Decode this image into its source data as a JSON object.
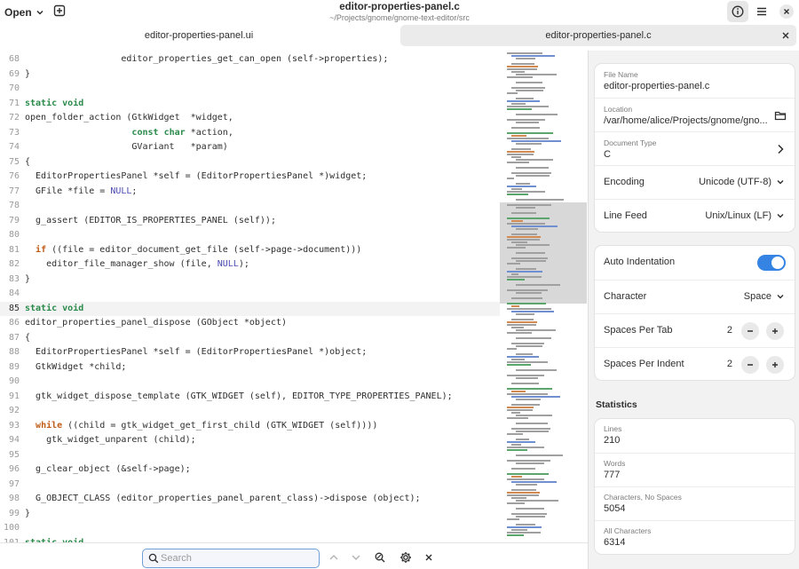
{
  "header": {
    "open_label": "Open",
    "title": "editor-properties-panel.c",
    "subtitle": "~/Projects/gnome/gnome-text-editor/src"
  },
  "tabs": [
    {
      "label": "editor-properties-panel.ui",
      "active": false
    },
    {
      "label": "editor-properties-panel.c",
      "active": true
    }
  ],
  "code_lines": [
    {
      "n": "68",
      "t": "                  editor_properties_get_can_open (self->properties);"
    },
    {
      "n": "69",
      "t": "}"
    },
    {
      "n": "70",
      "t": ""
    },
    {
      "n": "71",
      "t": "static void"
    },
    {
      "n": "72",
      "t": "open_folder_action (GtkWidget  *widget,"
    },
    {
      "n": "73",
      "t": "                    const char *action,"
    },
    {
      "n": "74",
      "t": "                    GVariant   *param)"
    },
    {
      "n": "75",
      "t": "{"
    },
    {
      "n": "76",
      "t": "  EditorPropertiesPanel *self = (EditorPropertiesPanel *)widget;"
    },
    {
      "n": "77",
      "t": "  GFile *file = NULL;"
    },
    {
      "n": "78",
      "t": ""
    },
    {
      "n": "79",
      "t": "  g_assert (EDITOR_IS_PROPERTIES_PANEL (self));"
    },
    {
      "n": "80",
      "t": ""
    },
    {
      "n": "81",
      "t": "  if ((file = editor_document_get_file (self->page->document)))"
    },
    {
      "n": "82",
      "t": "    editor_file_manager_show (file, NULL);"
    },
    {
      "n": "83",
      "t": "}"
    },
    {
      "n": "84",
      "t": ""
    },
    {
      "n": "85",
      "t": "static void"
    },
    {
      "n": "86",
      "t": "editor_properties_panel_dispose (GObject *object)"
    },
    {
      "n": "87",
      "t": "{"
    },
    {
      "n": "88",
      "t": "  EditorPropertiesPanel *self = (EditorPropertiesPanel *)object;"
    },
    {
      "n": "89",
      "t": "  GtkWidget *child;"
    },
    {
      "n": "90",
      "t": ""
    },
    {
      "n": "91",
      "t": "  gtk_widget_dispose_template (GTK_WIDGET (self), EDITOR_TYPE_PROPERTIES_PANEL);"
    },
    {
      "n": "92",
      "t": ""
    },
    {
      "n": "93",
      "t": "  while ((child = gtk_widget_get_first_child (GTK_WIDGET (self))))"
    },
    {
      "n": "94",
      "t": "    gtk_widget_unparent (child);"
    },
    {
      "n": "95",
      "t": ""
    },
    {
      "n": "96",
      "t": "  g_clear_object (&self->page);"
    },
    {
      "n": "97",
      "t": ""
    },
    {
      "n": "98",
      "t": "  G_OBJECT_CLASS (editor_properties_panel_parent_class)->dispose (object);"
    },
    {
      "n": "99",
      "t": "}"
    },
    {
      "n": "100",
      "t": ""
    },
    {
      "n": "101",
      "t": "static void"
    }
  ],
  "current_line": "85",
  "properties": {
    "file_name_label": "File Name",
    "file_name": "editor-properties-panel.c",
    "location_label": "Location",
    "location": "/var/home/alice/Projects/gnome/gno...",
    "doc_type_label": "Document Type",
    "doc_type": "C",
    "encoding_label": "Encoding",
    "encoding": "Unicode (UTF-8)",
    "line_feed_label": "Line Feed",
    "line_feed": "Unix/Linux (LF)"
  },
  "indentation": {
    "auto_label": "Auto Indentation",
    "auto_enabled": true,
    "character_label": "Character",
    "character": "Space",
    "spaces_per_tab_label": "Spaces Per Tab",
    "spaces_per_tab": "2",
    "spaces_per_indent_label": "Spaces Per Indent",
    "spaces_per_indent": "2"
  },
  "statistics": {
    "heading": "Statistics",
    "lines_label": "Lines",
    "lines": "210",
    "words_label": "Words",
    "words": "777",
    "chars_no_spaces_label": "Characters, No Spaces",
    "chars_no_spaces": "5054",
    "all_chars_label": "All Characters",
    "all_chars": "6314"
  },
  "search": {
    "placeholder": "Search"
  },
  "colors": {
    "accent": "#3584e4",
    "keyword_type": "#2a8a4a",
    "keyword_flow": "#c05e19",
    "null_constant": "#4b4bb0"
  },
  "icons": {
    "open_menu": "chevron-down-icon",
    "new_tab": "plus-square-icon",
    "properties": "info-icon",
    "main_menu": "hamburger-icon",
    "close_window": "close-icon",
    "open_folder": "folder-icon",
    "search": "search-icon",
    "prev_match": "chevron-up-icon",
    "next_match": "chevron-down-icon",
    "replace": "replace-icon",
    "search_options": "gear-icon",
    "close_search": "close-icon"
  }
}
